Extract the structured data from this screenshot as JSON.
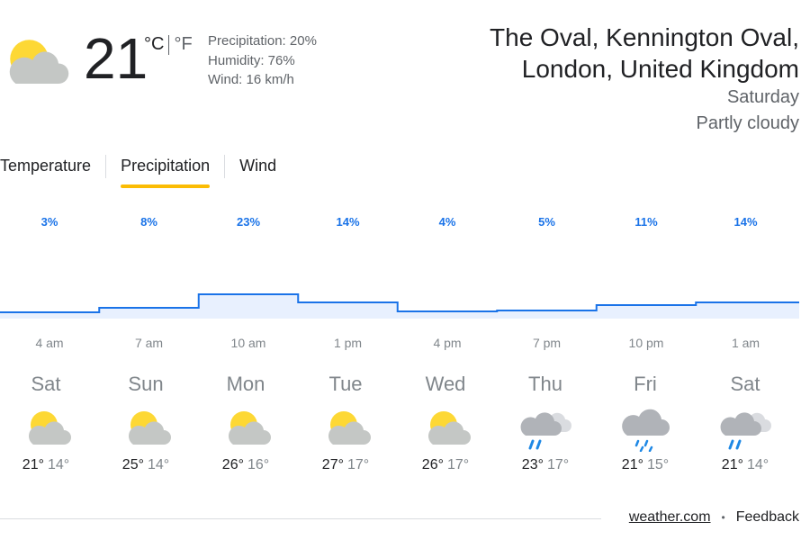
{
  "current": {
    "temperature": "21",
    "unit_c": "°C",
    "unit_f": "°F",
    "precipitation": "Precipitation: 20%",
    "humidity": "Humidity: 76%",
    "wind": "Wind: 16 km/h",
    "icon": "partly-cloudy-icon"
  },
  "location": {
    "line1": "The Oval, Kennington Oval,",
    "line2": "London, United Kingdom",
    "day": "Saturday",
    "condition": "Partly cloudy"
  },
  "tabs": [
    {
      "label": "Temperature",
      "active": false
    },
    {
      "label": "Precipitation",
      "active": true
    },
    {
      "label": "Wind",
      "active": false
    }
  ],
  "chart_data": {
    "type": "area",
    "labels": [
      "3%",
      "8%",
      "23%",
      "14%",
      "4%",
      "5%",
      "11%",
      "14%"
    ],
    "values": [
      3,
      8,
      23,
      14,
      4,
      5,
      11,
      14
    ],
    "x": [
      "4 am",
      "7 am",
      "10 am",
      "1 pm",
      "4 pm",
      "7 pm",
      "10 pm",
      "1 am"
    ],
    "ylim": [
      0,
      100
    ],
    "colors": {
      "line": "#1a73e8",
      "fill": "#e8f0fe",
      "label": "#1a73e8"
    }
  },
  "days": [
    {
      "name": "Sat",
      "icon": "partly-cloudy-icon",
      "high": "21°",
      "low": "14°",
      "selected": true
    },
    {
      "name": "Sun",
      "icon": "partly-cloudy-icon",
      "high": "25°",
      "low": "14°",
      "selected": false
    },
    {
      "name": "Mon",
      "icon": "partly-cloudy-icon",
      "high": "26°",
      "low": "16°",
      "selected": false
    },
    {
      "name": "Tue",
      "icon": "partly-cloudy-icon",
      "high": "27°",
      "low": "17°",
      "selected": false
    },
    {
      "name": "Wed",
      "icon": "partly-cloudy-icon",
      "high": "26°",
      "low": "17°",
      "selected": false
    },
    {
      "name": "Thu",
      "icon": "scattered-showers-icon",
      "high": "23°",
      "low": "17°",
      "selected": false
    },
    {
      "name": "Fri",
      "icon": "showers-icon",
      "high": "21°",
      "low": "15°",
      "selected": false
    },
    {
      "name": "Sat",
      "icon": "scattered-showers-icon",
      "high": "21°",
      "low": "14°",
      "selected": false
    }
  ],
  "footer": {
    "source": "weather.com",
    "separator": "•",
    "feedback": "Feedback"
  },
  "colors": {
    "accent_tab": "#fbbc04",
    "sun": "#fdd835",
    "cloud": "#c4c7c5",
    "rain": "#1e88e5"
  }
}
